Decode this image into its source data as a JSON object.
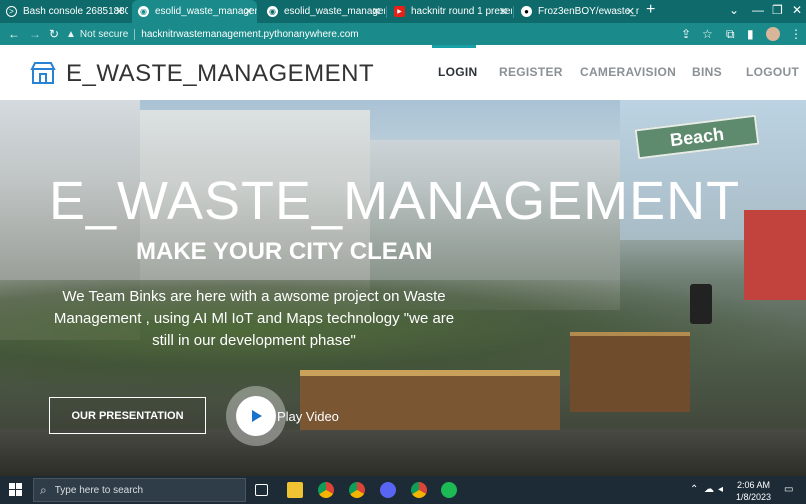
{
  "browser": {
    "tabs": [
      {
        "title": "Bash console 26851880 : P",
        "favicon": "bash-icon",
        "active": false
      },
      {
        "title": "esolid_waste_manageme",
        "favicon": "globe-icon",
        "active": true
      },
      {
        "title": "esolid_waste_manageme",
        "favicon": "globe-icon",
        "active": false
      },
      {
        "title": "hacknitr round 1 presenta",
        "favicon": "youtube-icon",
        "active": false
      },
      {
        "title": "Froz3enBOY/ewaste_man",
        "favicon": "github-icon",
        "active": false
      }
    ],
    "new_tab": "+",
    "security_label": "Not secure",
    "url": "hacknitrwastemanagement.pythonanywhere.com"
  },
  "site": {
    "brand": "E_WASTE_MANAGEMENT",
    "nav": [
      {
        "label": "LOGIN",
        "active": true
      },
      {
        "label": "REGISTER",
        "active": false
      },
      {
        "label": "CAMERAVISION",
        "active": false
      },
      {
        "label": "BINS",
        "active": false
      },
      {
        "label": "LOGOUT",
        "active": false
      }
    ],
    "hero": {
      "title": "E_WASTE_MANAGEMENT",
      "subtitle": "MAKE YOUR CITY CLEAN",
      "description": "We Team Binks are here with a awsome project on Waste Management , using AI Ml IoT and Maps technology \"we are still in our development phase\"",
      "presentation_button": "OUR PRESENTATION",
      "play_label": "Play Video",
      "sign_text": "Beach"
    }
  },
  "taskbar": {
    "search_placeholder": "Type here to search",
    "time": "2:06 AM",
    "date": "1/8/2023"
  },
  "colors": {
    "browser_frame": "#0f6b6b",
    "browser_toolbar": "#1a8a8a",
    "nav_active": "#2c3338",
    "nav_inactive": "#8a9196",
    "accent": "#19a0a6",
    "taskbar": "#1c2b36"
  }
}
